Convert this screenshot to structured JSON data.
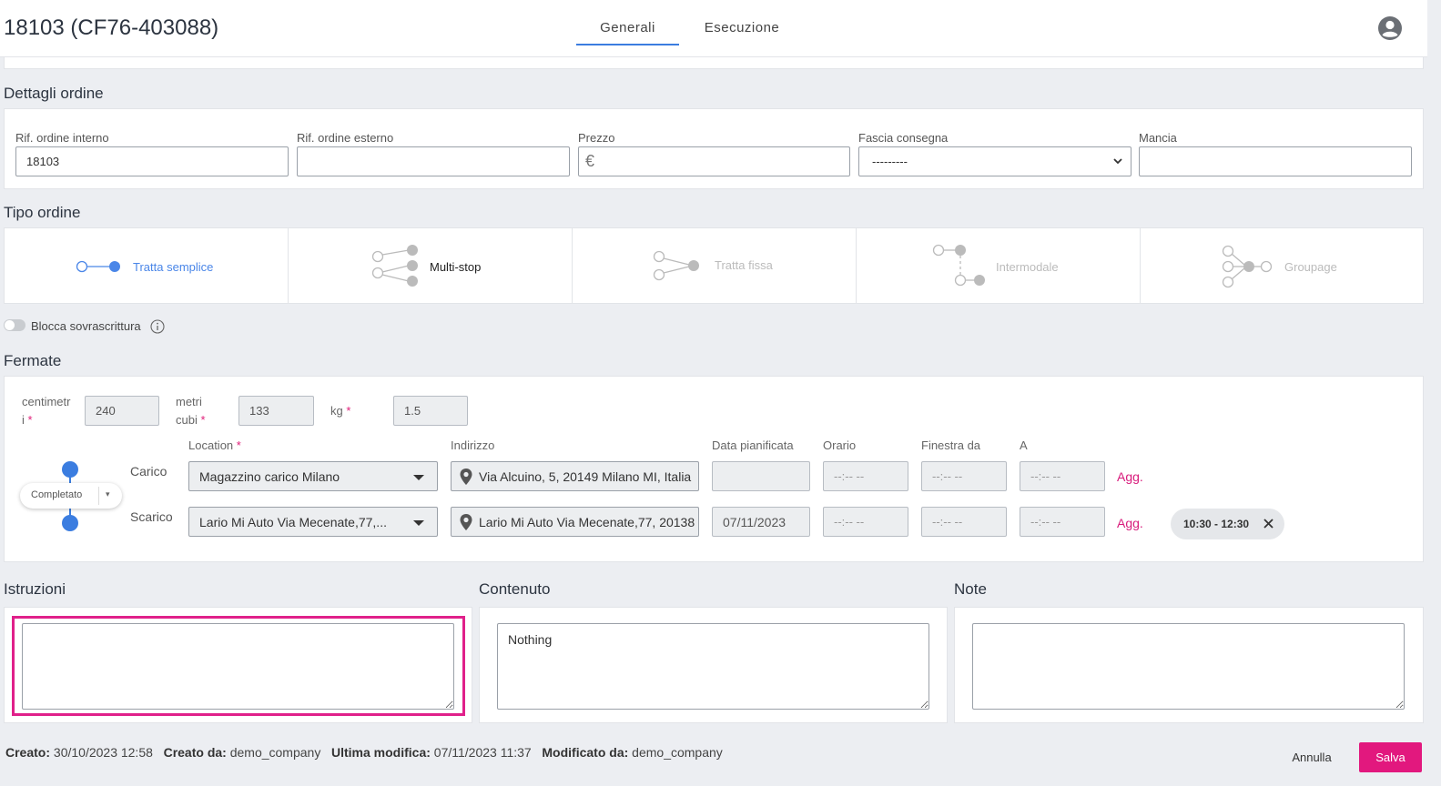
{
  "header": {
    "title": "18103 (CF76-403088)",
    "tabs": [
      {
        "label": "Generali",
        "active": true
      },
      {
        "label": "Esecuzione",
        "active": false
      }
    ],
    "avatar_icon": "user-circle-icon"
  },
  "dettagli": {
    "title": "Dettagli ordine",
    "fields": {
      "rif_interno": {
        "label": "Rif. ordine interno",
        "value": "18103"
      },
      "rif_esterno": {
        "label": "Rif. ordine esterno",
        "value": ""
      },
      "prezzo": {
        "label": "Prezzo",
        "currency": "€",
        "value": ""
      },
      "fascia": {
        "label": "Fascia consegna",
        "value": "---------"
      },
      "mancia": {
        "label": "Mancia",
        "value": ""
      }
    }
  },
  "tipo_ordine": {
    "title": "Tipo ordine",
    "options": [
      {
        "label": "Tratta semplice",
        "state": "selected"
      },
      {
        "label": "Multi-stop",
        "state": "enabled"
      },
      {
        "label": "Tratta fissa",
        "state": "disabled"
      },
      {
        "label": "Intermodale",
        "state": "disabled"
      },
      {
        "label": "Groupage",
        "state": "disabled"
      }
    ],
    "accent": "#4a86e8"
  },
  "blocca": {
    "label": "Blocca sovrascrittura",
    "enabled": false
  },
  "fermate": {
    "title": "Fermate",
    "dims": {
      "centimetri": {
        "label_1": "centimetr",
        "label_2": "i",
        "value": "240"
      },
      "metri_cubi": {
        "label_1": "metri",
        "label_2": "cubi",
        "value": "133"
      },
      "kg": {
        "label": "kg",
        "value": "1.5"
      },
      "required_mark": "*"
    },
    "columns": {
      "location": "Location",
      "indirizzo": "Indirizzo",
      "data": "Data pianificata",
      "orario": "Orario",
      "finestra_da": "Finestra da",
      "a": "A"
    },
    "status": "Completato",
    "stops": [
      {
        "type": "Carico",
        "location": "Magazzino carico Milano",
        "address": "Via Alcuino, 5, 20149 Milano MI, Italia",
        "date": "",
        "orario": "--:-- --",
        "finestra_da": "--:-- --",
        "a": "--:-- --",
        "agg": "Agg."
      },
      {
        "type": "Scarico",
        "location": "Lario Mi Auto Via Mecenate,77,...",
        "address": "Lario Mi Auto Via Mecenate,77, 20138",
        "date": "07/11/2023",
        "orario": "--:-- --",
        "finestra_da": "--:-- --",
        "a": "--:-- --",
        "agg": "Agg.",
        "time_window": "10:30 - 12:30"
      }
    ]
  },
  "istruzioni": {
    "title": "Istruzioni",
    "value": ""
  },
  "contenuto": {
    "title": "Contenuto",
    "value": "Nothing"
  },
  "note": {
    "title": "Note",
    "value": ""
  },
  "footer": {
    "creato_label": "Creato:",
    "creato_value": "30/10/2023 12:58",
    "creato_da_label": "Creato da:",
    "creato_da_value": "demo_company",
    "ultima_label": "Ultima modifica:",
    "ultima_value": "07/11/2023 11:37",
    "modificato_label": "Modificato da:",
    "modificato_value": "demo_company",
    "annulla": "Annulla",
    "salva": "Salva"
  },
  "colors": {
    "primary_blue": "#3b7de0",
    "accent_pink": "#e2187e"
  }
}
